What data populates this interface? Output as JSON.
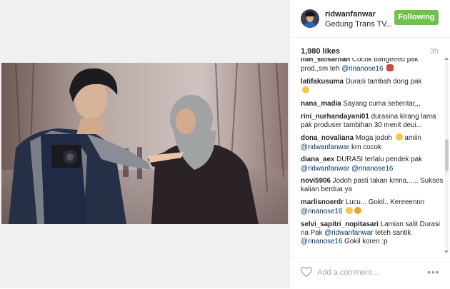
{
  "post": {
    "username": "ridwanfanwar",
    "location": "Gedung Trans TV...",
    "follow_label": "Following",
    "likes": "1,980 likes",
    "time": "3h",
    "add_comment_placeholder": "Add a comment...",
    "more_label": "•••"
  },
  "colors": {
    "follow_button": "#70c050",
    "mention": "#003569",
    "muted": "#a5a7aa"
  },
  "comments": [
    {
      "user": "ifah_sitisarifah",
      "text": "Cocok bangeeed pak prod,,sm teh ",
      "mention": "@rinanose16",
      "after": "",
      "emoji": "couple-emoji"
    },
    {
      "user": "latifakusuma",
      "text": "Durasi tambah dong pak ",
      "mention": "",
      "after": "",
      "emoji": "smile-emoji"
    },
    {
      "user": "nana_madia",
      "text": "Sayang cuma sebentar,,,",
      "mention": "",
      "after": "",
      "emoji": ""
    },
    {
      "user": "rini_nurhandayani01",
      "text": "durasina kirang lama pak produser tambihan 30 menit deui...",
      "mention": "",
      "after": "",
      "emoji": ""
    },
    {
      "user": "dona_novaliana",
      "text": "Moga jodoh ",
      "mention": "@ridwanfanwar",
      "after": " krn cocok",
      "emoji": "smile-emoji",
      "emoji_after": " amiin"
    },
    {
      "user": "diana_aex",
      "text": "DURASI terlalu pendek pak ",
      "mention": "@ridwanfanwar",
      "mention2": "@rinanose16",
      "after": "",
      "emoji": ""
    },
    {
      "user": "novi5906",
      "text": "Jodoh pasti takan kmna...... Sukses kalian berdua ya",
      "mention": "",
      "after": "",
      "emoji": ""
    },
    {
      "user": "marlisnoerdr",
      "text": "Lucu... Gokil.. Kereeennn ",
      "mention": "@rinanose16",
      "after": "",
      "emoji": "grin-emoji"
    },
    {
      "user": "selvi_sapitri_nopitasari",
      "text": "Lamian salit Durasi na Pak ",
      "mention": "@ridwanfanwar",
      "after": " teteh santik ",
      "mention2": "@rinanose16",
      "after2": " Gokil koren :p",
      "emoji": ""
    }
  ]
}
